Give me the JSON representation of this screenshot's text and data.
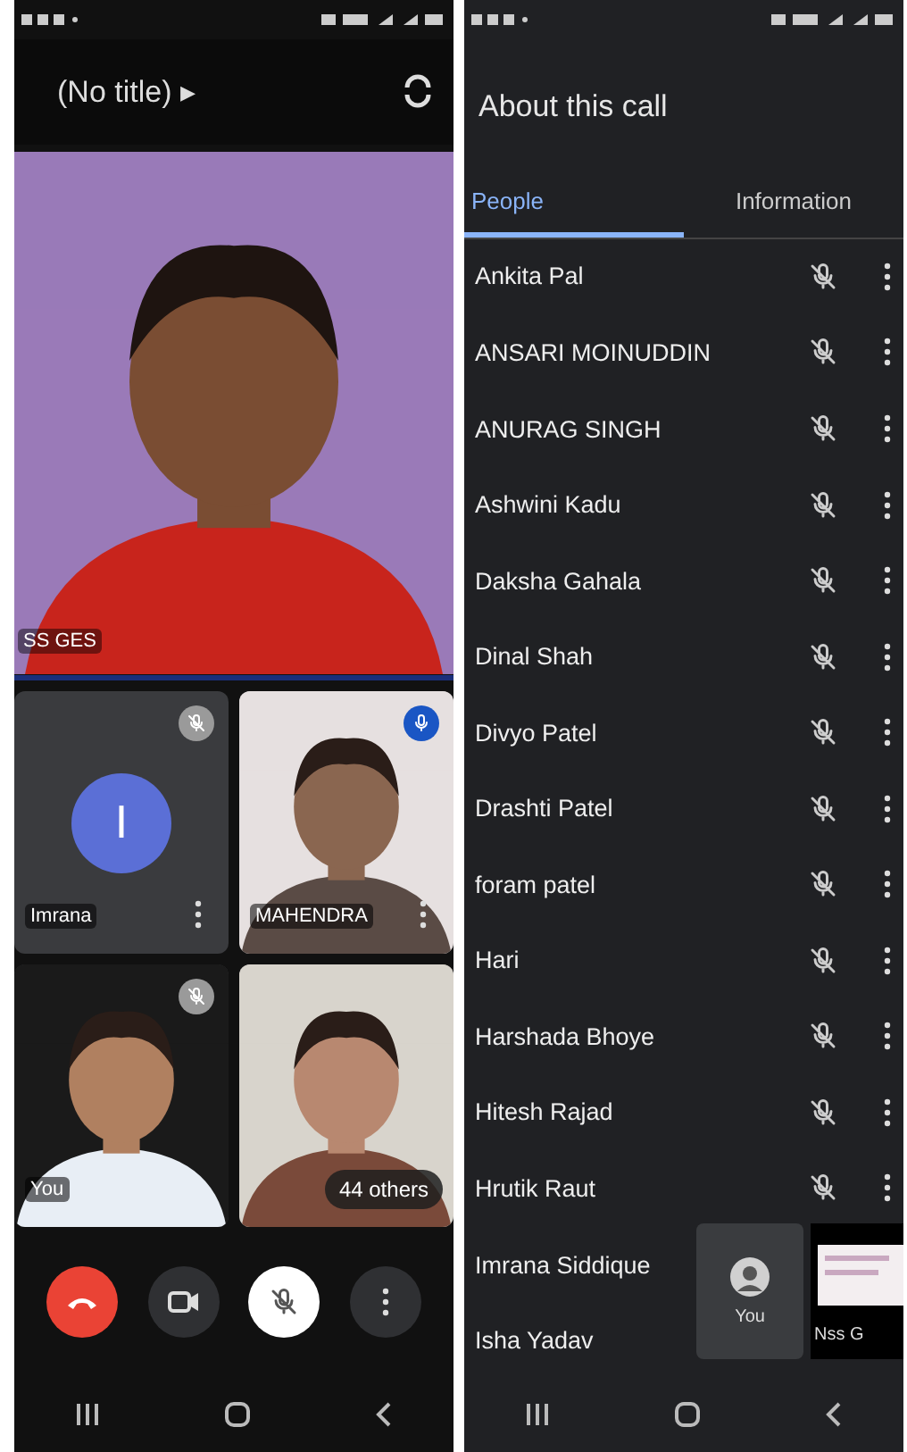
{
  "call_screen": {
    "title": "(No title)",
    "title_caret": "▸",
    "main_tile": {
      "name": "SS GES",
      "kind": "picture"
    },
    "tiles": [
      {
        "name": "Imrana",
        "kind": "avatar",
        "initial": "I",
        "muted": true,
        "menu": true
      },
      {
        "name": "MAHENDRA",
        "kind": "picture",
        "muted": false,
        "speaking": true,
        "menu": true
      },
      {
        "name": "You",
        "kind": "picture",
        "muted": true
      },
      {
        "name": "44 others",
        "kind": "others"
      }
    ],
    "mic_muted": true
  },
  "about_screen": {
    "title": "About this call",
    "tabs": [
      {
        "label": "People",
        "selected": true
      },
      {
        "label": "Information",
        "selected": false
      }
    ],
    "people": [
      {
        "name": "Ankita Pal",
        "muted": true
      },
      {
        "name": "ANSARI MOINUDDIN",
        "muted": true
      },
      {
        "name": "ANURAG SINGH",
        "muted": true
      },
      {
        "name": "Ashwini Kadu",
        "muted": true
      },
      {
        "name": "Daksha Gahala",
        "muted": true
      },
      {
        "name": "Dinal Shah",
        "muted": true
      },
      {
        "name": "Divyo Patel",
        "muted": true
      },
      {
        "name": "Drashti Patel",
        "muted": true
      },
      {
        "name": "foram patel",
        "muted": true
      },
      {
        "name": "Hari",
        "muted": true
      },
      {
        "name": "Harshada Bhoye",
        "muted": true
      },
      {
        "name": "Hitesh Rajad",
        "muted": true
      },
      {
        "name": "Hrutik Raut",
        "muted": true
      },
      {
        "name": "Imrana Siddique"
      },
      {
        "name": "Isha Yadav"
      }
    ],
    "pip": [
      {
        "name": "You",
        "kind": "avatar"
      },
      {
        "name": "Nss G",
        "kind": "screen"
      }
    ]
  }
}
